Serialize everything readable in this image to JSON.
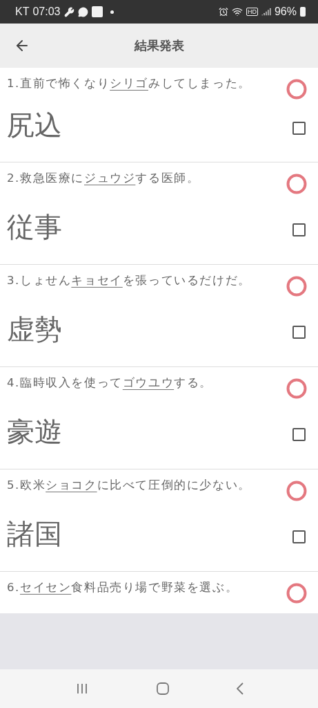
{
  "status_bar": {
    "carrier": "KT",
    "time": "07:03",
    "hd": "HD",
    "battery": "96%"
  },
  "app_bar": {
    "title": "結果発表"
  },
  "questions": [
    {
      "number": "1.",
      "before": "直前で怖くなり",
      "target": "シリゴ",
      "after": "みしてしまった。",
      "answer": "尻込",
      "correct": true,
      "checked": false
    },
    {
      "number": "2.",
      "before": "救急医療に",
      "target": "ジュウジ",
      "after": "する医師。",
      "answer": "従事",
      "correct": true,
      "checked": false
    },
    {
      "number": "3.",
      "before": "しょせん",
      "target": "キョセイ",
      "after": "を張っているだけだ。",
      "answer": "虚勢",
      "correct": true,
      "checked": false
    },
    {
      "number": "4.",
      "before": "臨時収入を使って",
      "target": "ゴウユウ",
      "after": "する。",
      "answer": "豪遊",
      "correct": true,
      "checked": false
    },
    {
      "number": "5.",
      "before": "欧米",
      "target": "ショコク",
      "after": "に比べて圧倒的に少ない。",
      "answer": "諸国",
      "correct": true,
      "checked": false
    },
    {
      "number": "6.",
      "target": "セイセン",
      "after": "食料品売り場で野菜を選ぶ。",
      "correct": true
    }
  ]
}
